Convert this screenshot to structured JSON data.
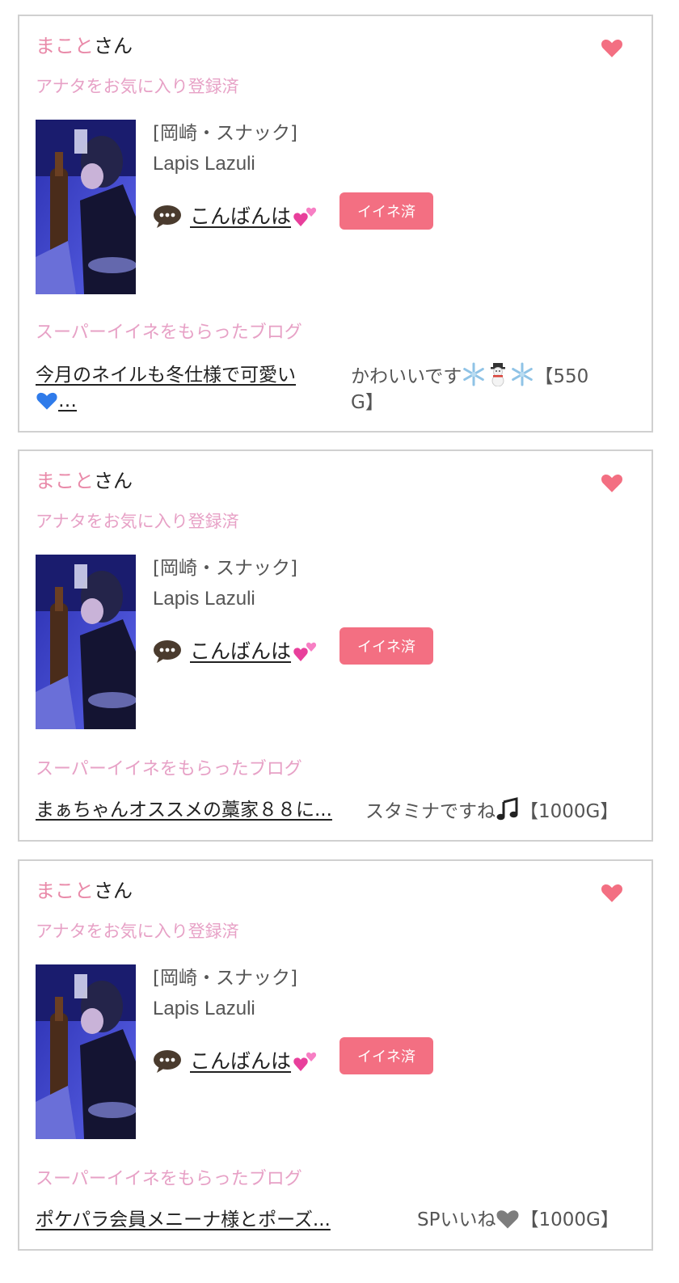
{
  "items": [
    {
      "user_name": "まこと",
      "user_suffix": "さん",
      "fav_status": "アナタをお気に入り登録済",
      "shop_category": "[岡崎・スナック]",
      "shop_name": "Lapis Lazuli",
      "message": "こんばんは",
      "like_label": "イイネ済",
      "section_label": "スーパーイイネをもらったブログ",
      "blog_title_line1": "今月のネイルも冬仕様で可愛い",
      "blog_title_line2": "…",
      "comment_line1": "かわいいです",
      "comment_line1_tail": "【550",
      "comment_line2": "G】"
    },
    {
      "user_name": "まこと",
      "user_suffix": "さん",
      "fav_status": "アナタをお気に入り登録済",
      "shop_category": "[岡崎・スナック]",
      "shop_name": "Lapis Lazuli",
      "message": "こんばんは",
      "like_label": "イイネ済",
      "section_label": "スーパーイイネをもらったブログ",
      "blog_title": "まぁちゃんオススメの藁家８８に...",
      "comment_text": "スタミナですね",
      "comment_tail": "【1000G】"
    },
    {
      "user_name": "まこと",
      "user_suffix": "さん",
      "fav_status": "アナタをお気に入り登録済",
      "shop_category": "[岡崎・スナック]",
      "shop_name": "Lapis Lazuli",
      "message": "こんばんは",
      "like_label": "イイネ済",
      "section_label": "スーパーイイネをもらったブログ",
      "blog_title": "ポケパラ会員メニーナ様とポーズ...",
      "comment_text": "SPいいね",
      "comment_tail": "【1000G】"
    }
  ],
  "colors": {
    "accent_pink": "#f36f82",
    "label_pink": "#e7a1c6",
    "name_pink": "#e98aa9",
    "border": "#d0d0d0"
  },
  "icons": {
    "heart": "heart-icon",
    "message": "speech-bubble-icon",
    "two_hearts": "two-hearts-emoji",
    "blue_heart": "blue-heart-emoji",
    "snowflake": "snowflake-emoji",
    "snowman": "snowman-emoji",
    "music": "music-note-emoji",
    "gray_heart": "gray-heart-emoji"
  }
}
